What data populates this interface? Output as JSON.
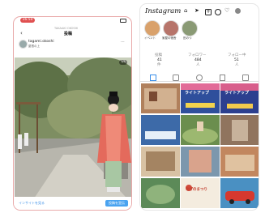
{
  "left_screen": {
    "status_time": "16:50",
    "header_user": "TAKAAKI OKOSHI",
    "header_title": "投稿",
    "account_name": "tagami.okoshi",
    "location": "屋根の上",
    "photo_counter": "1/3",
    "insights_link": "インサイトを見る",
    "promote_button": "投稿を宣伝"
  },
  "right_screen": {
    "brand": "Instagram",
    "highlights": [
      {
        "label": "イベント"
      },
      {
        "label": "家屋の宿舎"
      },
      {
        "label": "田のつ"
      }
    ],
    "stats": [
      {
        "label": "投稿",
        "value": "41"
      },
      {
        "label": "フォロワー",
        "value": "484"
      },
      {
        "label": "フォロー中",
        "value": "51"
      }
    ],
    "stat_units": [
      "件",
      "人",
      "人"
    ],
    "grid_captions": [
      "ライトアップ",
      "ライトアップ",
      "なげのまつり"
    ]
  },
  "colors": {
    "accent": "#4aa3f0",
    "badge": "#e05050",
    "border_left": "#e9a9a9"
  }
}
